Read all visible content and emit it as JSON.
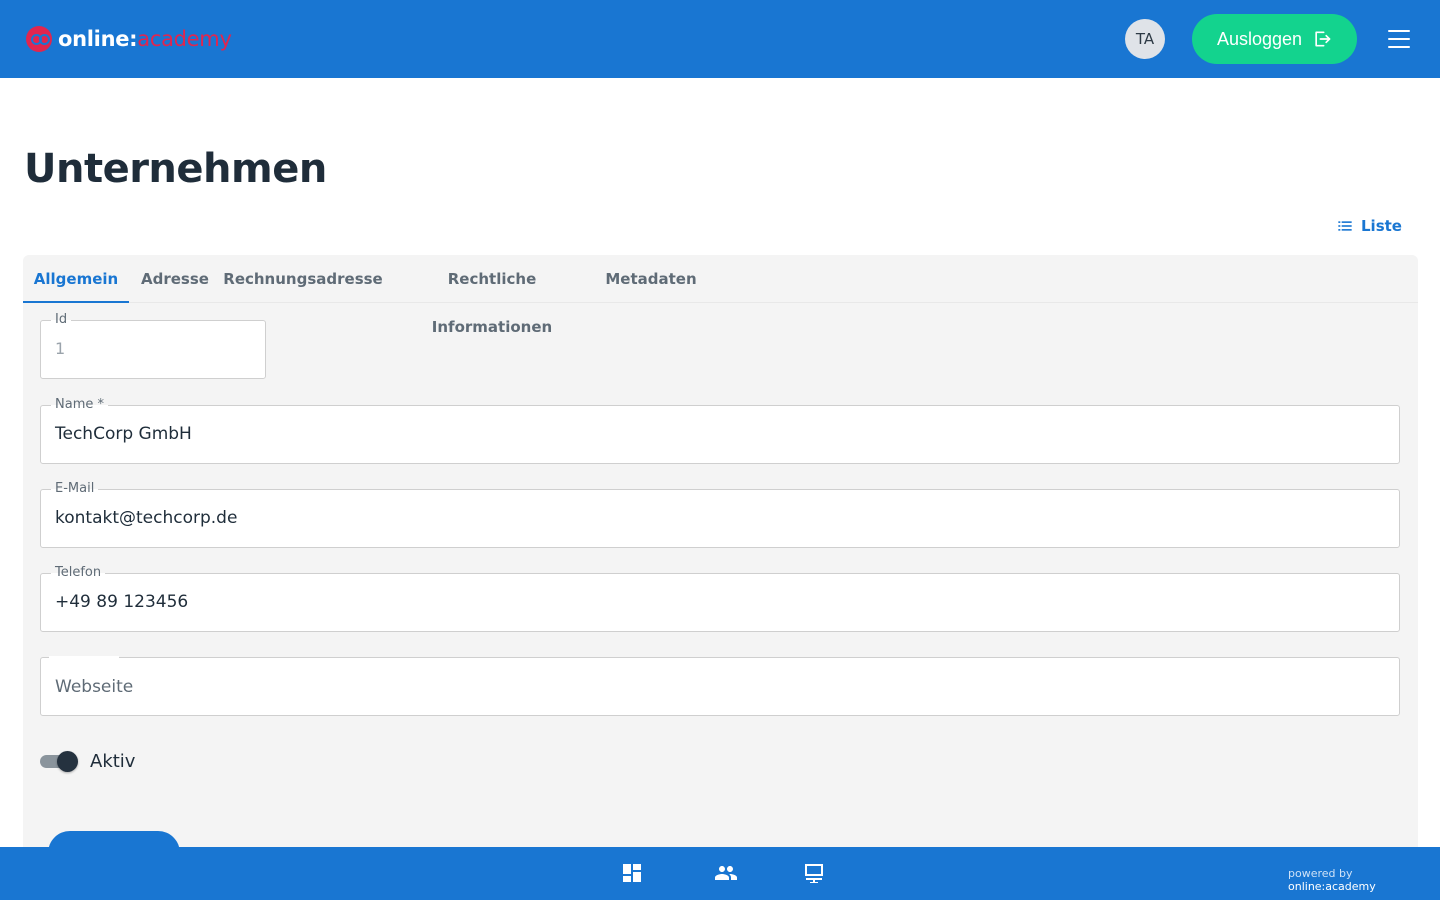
{
  "header": {
    "logo_part1": "online:",
    "logo_part2": "academy",
    "avatar_initials": "TA",
    "logout_label": "Ausloggen"
  },
  "page": {
    "title": "Unternehmen",
    "list_link_label": "Liste"
  },
  "tabs": [
    {
      "label": "Allgemein",
      "active": true
    },
    {
      "label": "Adresse",
      "active": false
    },
    {
      "label": "Rechnungsadresse",
      "active": false
    },
    {
      "label": "Rechtliche Informationen",
      "active": false
    },
    {
      "label": "Metadaten",
      "active": false
    }
  ],
  "form": {
    "id": {
      "label": "Id",
      "value": "1"
    },
    "name": {
      "label": "Name *",
      "value": "TechCorp GmbH"
    },
    "email": {
      "label": "E-Mail",
      "value": "kontakt@techcorp.de"
    },
    "phone": {
      "label": "Telefon",
      "value": "+49 89 123456"
    },
    "website": {
      "placeholder": "Webseite",
      "value": ""
    },
    "active": {
      "label": "Aktiv",
      "checked": true
    }
  },
  "footer": {
    "powered_prefix": "powered by",
    "powered_brand": "online:academy"
  },
  "colors": {
    "primary": "#1976d2",
    "accent_green": "#13d38e",
    "brand_red": "#e0264f"
  }
}
